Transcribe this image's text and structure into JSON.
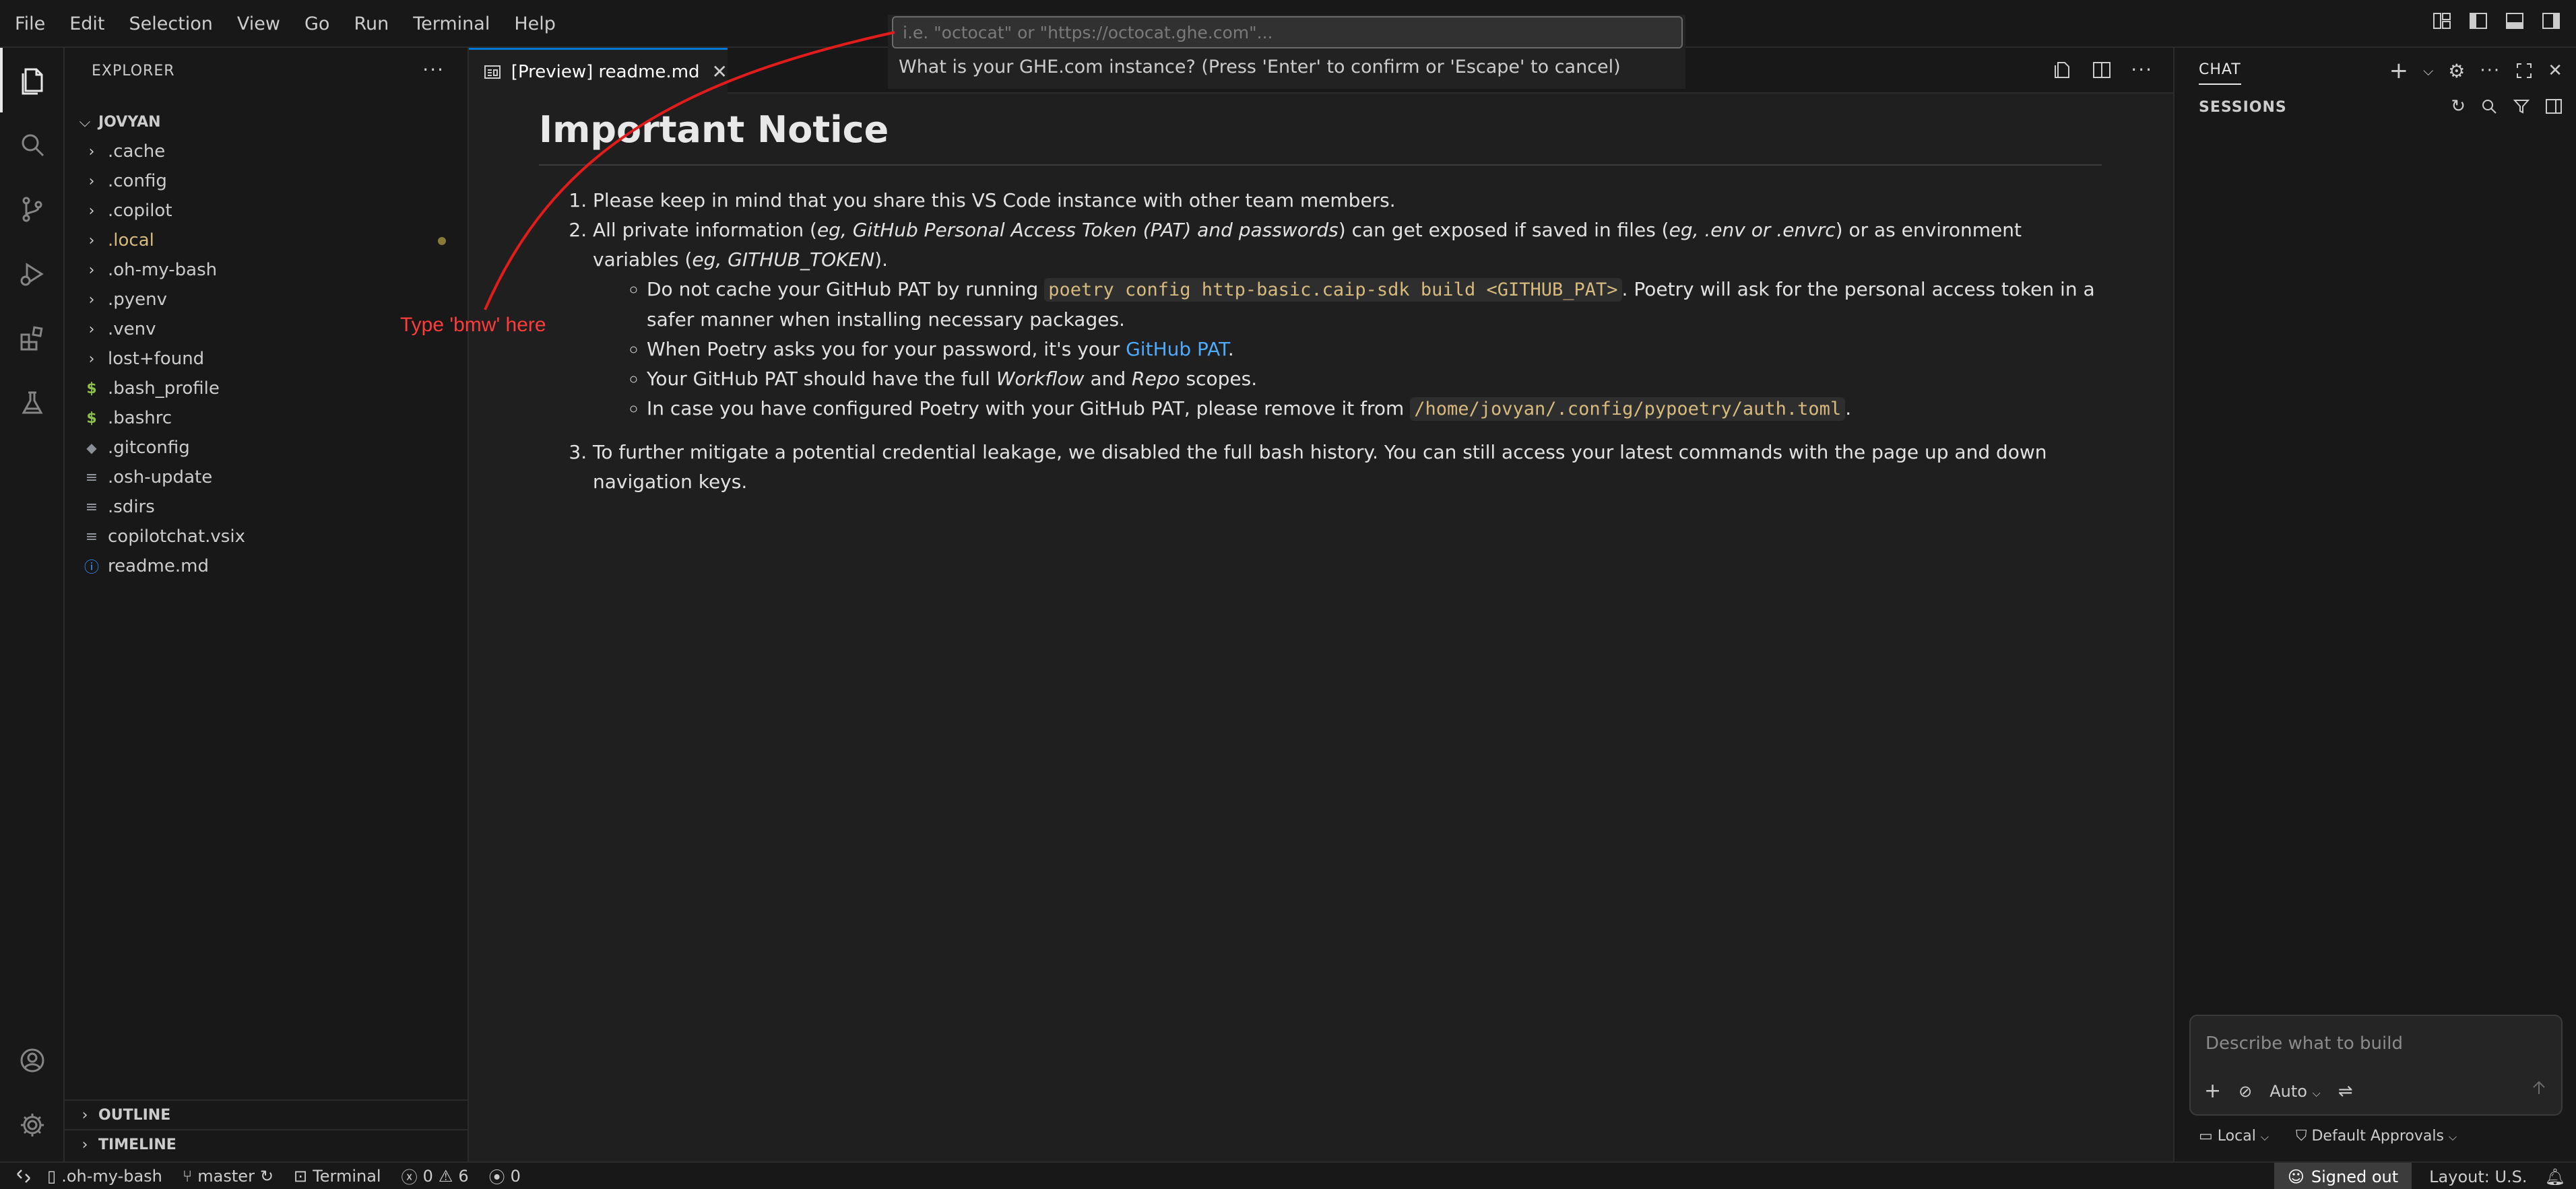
{
  "menu": [
    "File",
    "Edit",
    "Selection",
    "View",
    "Go",
    "Run",
    "Terminal",
    "Help"
  ],
  "sidebar": {
    "title": "EXPLORER",
    "more": "···",
    "root": "JOVYAN",
    "items": [
      {
        "name": ".cache",
        "type": "folder"
      },
      {
        "name": ".config",
        "type": "folder"
      },
      {
        "name": ".copilot",
        "type": "folder"
      },
      {
        "name": ".local",
        "type": "folder"
      },
      {
        "name": ".oh-my-bash",
        "type": "folder"
      },
      {
        "name": ".pyenv",
        "type": "folder"
      },
      {
        "name": ".venv",
        "type": "folder"
      },
      {
        "name": "lost+found",
        "type": "folder"
      },
      {
        "name": ".bash_profile",
        "type": "shell"
      },
      {
        "name": ".bashrc",
        "type": "shell"
      },
      {
        "name": ".gitconfig",
        "type": "git"
      },
      {
        "name": ".osh-update",
        "type": "text"
      },
      {
        "name": ".sdirs",
        "type": "text"
      },
      {
        "name": "copilotchat.vsix",
        "type": "text"
      },
      {
        "name": "readme.md",
        "type": "info"
      }
    ],
    "outline": "OUTLINE",
    "timeline": "TIMELINE"
  },
  "editor": {
    "tab_label": "[Preview] readme.md",
    "heading": "Important Notice",
    "item1": "Please keep in mind that you share this VS Code instance with other team members.",
    "item2": {
      "a": "All private information (",
      "b": "eg, GitHub Personal Access Token (PAT) and passwords",
      "c": ") can get exposed if saved in files (",
      "d": "eg, .env or .envrc",
      "e": ") or as environment variables (",
      "f": "eg, GITHUB_TOKEN",
      "g": ")."
    },
    "sub1": {
      "a": "Do not cache your GitHub PAT by running ",
      "code": "poetry config http-basic.caip-sdk build <GITHUB_PAT>",
      "b": ". Poetry will ask for the personal access token in a safer manner when installing necessary packages."
    },
    "sub2": {
      "a": "When Poetry asks you for your password, it's your ",
      "link": "GitHub PAT",
      "b": "."
    },
    "sub3": {
      "a": "Your GitHub PAT should have the full ",
      "w": "Workflow",
      "and": " and ",
      "r": "Repo",
      "b": " scopes."
    },
    "sub4": {
      "a": "In case you have configured Poetry with your GitHub PAT, please remove it from ",
      "code": "/home/jovyan/.config/pypoetry/auth.toml",
      "b": "."
    },
    "item3": "To further mitigate a potential credential leakage, we disabled the full bash history. You can still access your latest commands with the page up and down navigation keys."
  },
  "quick_input": {
    "placeholder": "i.e. \"octocat\" or \"https://octocat.ghe.com\"...",
    "message": "What is your GHE.com instance? (Press 'Enter' to confirm or 'Escape' to cancel)"
  },
  "annotation": {
    "text": "Type 'bmw' here",
    "color": "#ff3b3b"
  },
  "chat": {
    "title": "CHAT",
    "sessions": "SESSIONS",
    "input_placeholder": "Describe what to build",
    "mode": "Auto",
    "location": "Local",
    "approvals": "Default Approvals"
  },
  "statusbar": {
    "terminal_name": ".oh-my-bash",
    "branch": "master",
    "terminal": "Terminal",
    "errors": "0",
    "warnings": "6",
    "ports": "0",
    "signed_out": "Signed out",
    "layout": "Layout: U.S."
  },
  "colors": {
    "accent": "#0078d4",
    "link": "#4daafc",
    "modified": "#d7ba7d"
  }
}
